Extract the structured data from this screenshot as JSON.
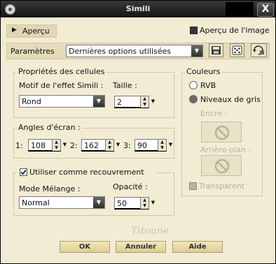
{
  "window": {
    "title": "Simili",
    "close_glyph": "X"
  },
  "preview": {
    "toggle_label": "Aperçu",
    "show_image_label": "Aperçu de l'image"
  },
  "params": {
    "label": "Paramètres",
    "preset_value": "Dernières options utilisées"
  },
  "cells": {
    "group_title": "Propriétés des cellules",
    "motif_label": "Motif de l'effet Simili :",
    "motif_value": "Rond",
    "size_label": "Taille :",
    "size_value": "2"
  },
  "angles": {
    "group_title": "Angles d'écran :",
    "items": [
      {
        "label": "1:",
        "value": "108"
      },
      {
        "label": "2:",
        "value": "162"
      },
      {
        "label": "3:",
        "value": "90"
      }
    ]
  },
  "overlay": {
    "checkbox_label": "Utiliser comme recouvrement",
    "blend_label": "Mode Mélange :",
    "blend_value": "Normal",
    "opacity_label": "Opacité :",
    "opacity_value": "50"
  },
  "colors": {
    "group_title": "Couleurs",
    "rvb_label": "RVB",
    "gray_label": "Niveaux de gris",
    "ink_label": "Encre :",
    "background_label": "Arrière-plan :",
    "transparent_label": "Transparent"
  },
  "signature": "Titoune",
  "buttons": {
    "ok": "OK",
    "cancel": "Annuler",
    "help": "Aide"
  }
}
